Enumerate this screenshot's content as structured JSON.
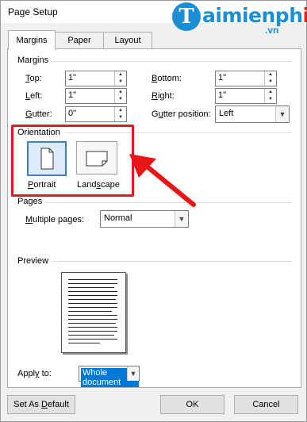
{
  "window": {
    "title": "Page Setup"
  },
  "brand": {
    "name_prefix": "T",
    "name_main": "aimienph",
    "name_i": "i",
    "suffix": ".vn"
  },
  "tabs": [
    {
      "label": "Margins"
    },
    {
      "label": "Paper"
    },
    {
      "label": "Layout"
    }
  ],
  "margins": {
    "group_label": "Margins",
    "top": {
      "label": "Top:",
      "value": "1\""
    },
    "bottom": {
      "label": "Bottom:",
      "value": "1\""
    },
    "left": {
      "label": "Left:",
      "value": "1\""
    },
    "right": {
      "label": "Right:",
      "value": "1\""
    },
    "gutter": {
      "label": "Gutter:",
      "value": "0\""
    },
    "gutter_position": {
      "label": "Gutter position:",
      "value": "Left"
    }
  },
  "orientation": {
    "group_label": "Orientation",
    "portrait": "Portrait",
    "landscape": "Landscape",
    "selected": "Portrait"
  },
  "pages": {
    "group_label": "Pages",
    "multiple_label": "Multiple pages:",
    "multiple_value": "Normal"
  },
  "preview": {
    "group_label": "Preview"
  },
  "apply": {
    "label": "Apply to:",
    "value": "Whole document"
  },
  "buttons": {
    "set_default": "Set As Default",
    "ok": "OK",
    "cancel": "Cancel"
  },
  "colors": {
    "highlight": "#e81616",
    "accent": "#0078d7",
    "brand": "#1a8fd8"
  }
}
